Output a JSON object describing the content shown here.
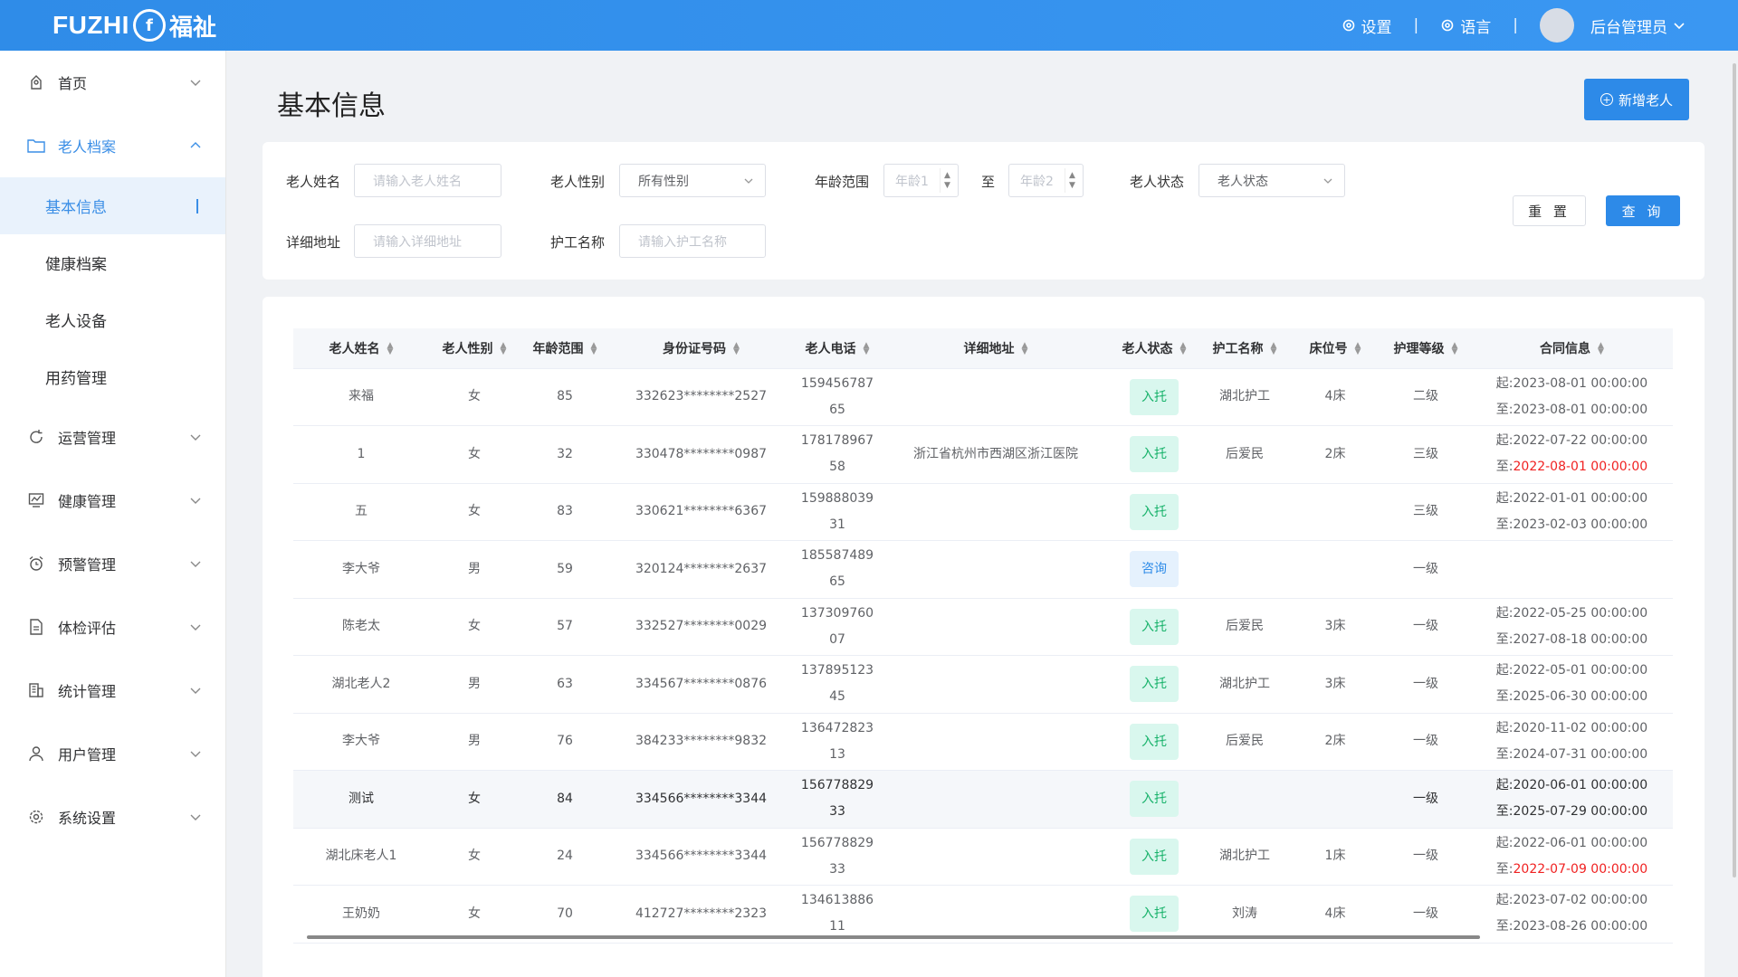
{
  "header": {
    "logo_text": "FUZHI",
    "logo_cn": "福祉",
    "settings_label": "设置",
    "language_label": "语言",
    "sep": "|",
    "user_label": "后台管理员"
  },
  "sidebar": {
    "home": "首页",
    "elder_archive": "老人档案",
    "sub_items": [
      "基本信息",
      "健康档案",
      "老人设备",
      "用药管理"
    ],
    "menus": [
      "运营管理",
      "健康管理",
      "预警管理",
      "体检评估",
      "统计管理",
      "用户管理",
      "系统设置"
    ]
  },
  "main": {
    "title": "基本信息",
    "add_button": "新增老人"
  },
  "filters": {
    "name_label": "老人姓名",
    "name_placeholder": "请输入老人姓名",
    "gender_label": "老人性别",
    "gender_value": "所有性别",
    "age_label": "年龄范围",
    "age1_placeholder": "年龄1",
    "age_to": "至",
    "age2_placeholder": "年龄2",
    "status_label": "老人状态",
    "status_value": "老人状态",
    "address_label": "详细地址",
    "address_placeholder": "请输入详细地址",
    "nurse_label": "护工名称",
    "nurse_placeholder": "请输入护工名称",
    "reset_button": "重 置",
    "query_button": "查 询"
  },
  "table": {
    "columns": [
      "老人姓名",
      "老人性别",
      "年龄范围",
      "身份证号码",
      "老人电话",
      "详细地址",
      "老人状态",
      "护工名称",
      "床位号",
      "护理等级",
      "合同信息"
    ],
    "rows": [
      {
        "name": "来福",
        "gender": "女",
        "age": "85",
        "id": "332623********2527",
        "phone1": "159456787",
        "phone2": "65",
        "address": "",
        "status": "入托",
        "nurse": "湖北护工",
        "bed": "4床",
        "level": "二级",
        "start": "起:2023-08-01 00:00:00",
        "end_prefix": "至:",
        "end": "2023-08-01 00:00:00"
      },
      {
        "name": "1",
        "gender": "女",
        "age": "32",
        "id": "330478********0987",
        "phone1": "178178967",
        "phone2": "58",
        "address": "浙江省杭州市西湖区浙江医院",
        "status": "入托",
        "nurse": "后爱民",
        "bed": "2床",
        "level": "三级",
        "start": "起:2022-07-22 00:00:00",
        "end_prefix": "至:",
        "end": "2022-08-01 00:00:00"
      },
      {
        "name": "五",
        "gender": "女",
        "age": "83",
        "id": "330621********6367",
        "phone1": "159888039",
        "phone2": "31",
        "address": "",
        "status": "入托",
        "nurse": "",
        "bed": "",
        "level": "三级",
        "start": "起:2022-01-01 00:00:00",
        "end_prefix": "至:",
        "end": "2023-02-03 00:00:00"
      },
      {
        "name": "李大爷",
        "gender": "男",
        "age": "59",
        "id": "320124********2637",
        "phone1": "185587489",
        "phone2": "65",
        "address": "",
        "status": "咨询",
        "nurse": "",
        "bed": "",
        "level": "一级",
        "start": "",
        "end_prefix": "",
        "end": ""
      },
      {
        "name": "陈老太",
        "gender": "女",
        "age": "57",
        "id": "332527********0029",
        "phone1": "137309760",
        "phone2": "07",
        "address": "",
        "status": "入托",
        "nurse": "后爱民",
        "bed": "3床",
        "level": "一级",
        "start": "起:2022-05-25 00:00:00",
        "end_prefix": "至:",
        "end": "2027-08-18 00:00:00"
      },
      {
        "name": "湖北老人2",
        "gender": "男",
        "age": "63",
        "id": "334567********0876",
        "phone1": "137895123",
        "phone2": "45",
        "address": "",
        "status": "入托",
        "nurse": "湖北护工",
        "bed": "3床",
        "level": "一级",
        "start": "起:2022-05-01 00:00:00",
        "end_prefix": "至:",
        "end": "2025-06-30 00:00:00"
      },
      {
        "name": "李大爷",
        "gender": "男",
        "age": "76",
        "id": "384233********9832",
        "phone1": "136472823",
        "phone2": "13",
        "address": "",
        "status": "入托",
        "nurse": "后爱民",
        "bed": "2床",
        "level": "一级",
        "start": "起:2020-11-02 00:00:00",
        "end_prefix": "至:",
        "end": "2024-07-31 00:00:00"
      },
      {
        "name": "测试",
        "gender": "女",
        "age": "84",
        "id": "334566********3344",
        "phone1": "156778829",
        "phone2": "33",
        "address": "",
        "status": "入托",
        "nurse": "",
        "bed": "",
        "level": "一级",
        "start": "起:2020-06-01 00:00:00",
        "end_prefix": "至:",
        "end": "2025-07-29 00:00:00"
      },
      {
        "name": "湖北床老人1",
        "gender": "女",
        "age": "24",
        "id": "334566********3344",
        "phone1": "156778829",
        "phone2": "33",
        "address": "",
        "status": "入托",
        "nurse": "湖北护工",
        "bed": "1床",
        "level": "一级",
        "start": "起:2022-06-01 00:00:00",
        "end_prefix": "至:",
        "end": "2022-07-09 00:00:00"
      },
      {
        "name": "王奶奶",
        "gender": "女",
        "age": "70",
        "id": "412727********2323",
        "phone1": "134613886",
        "phone2": "11",
        "address": "",
        "status": "入托",
        "nurse": "刘涛",
        "bed": "4床",
        "level": "一级",
        "start": "起:2023-07-02 00:00:00",
        "end_prefix": "至:",
        "end": "2023-08-26 00:00:00"
      }
    ],
    "expired_end_rows": [
      1,
      8
    ],
    "highlighted_row": 7
  },
  "colors": {
    "primary": "#2d8ae8",
    "tag_in_bg": "#d9f7ee",
    "tag_in_fg": "#17b26a",
    "tag_consult_bg": "#e5f1fd",
    "expired": "#f02222"
  }
}
